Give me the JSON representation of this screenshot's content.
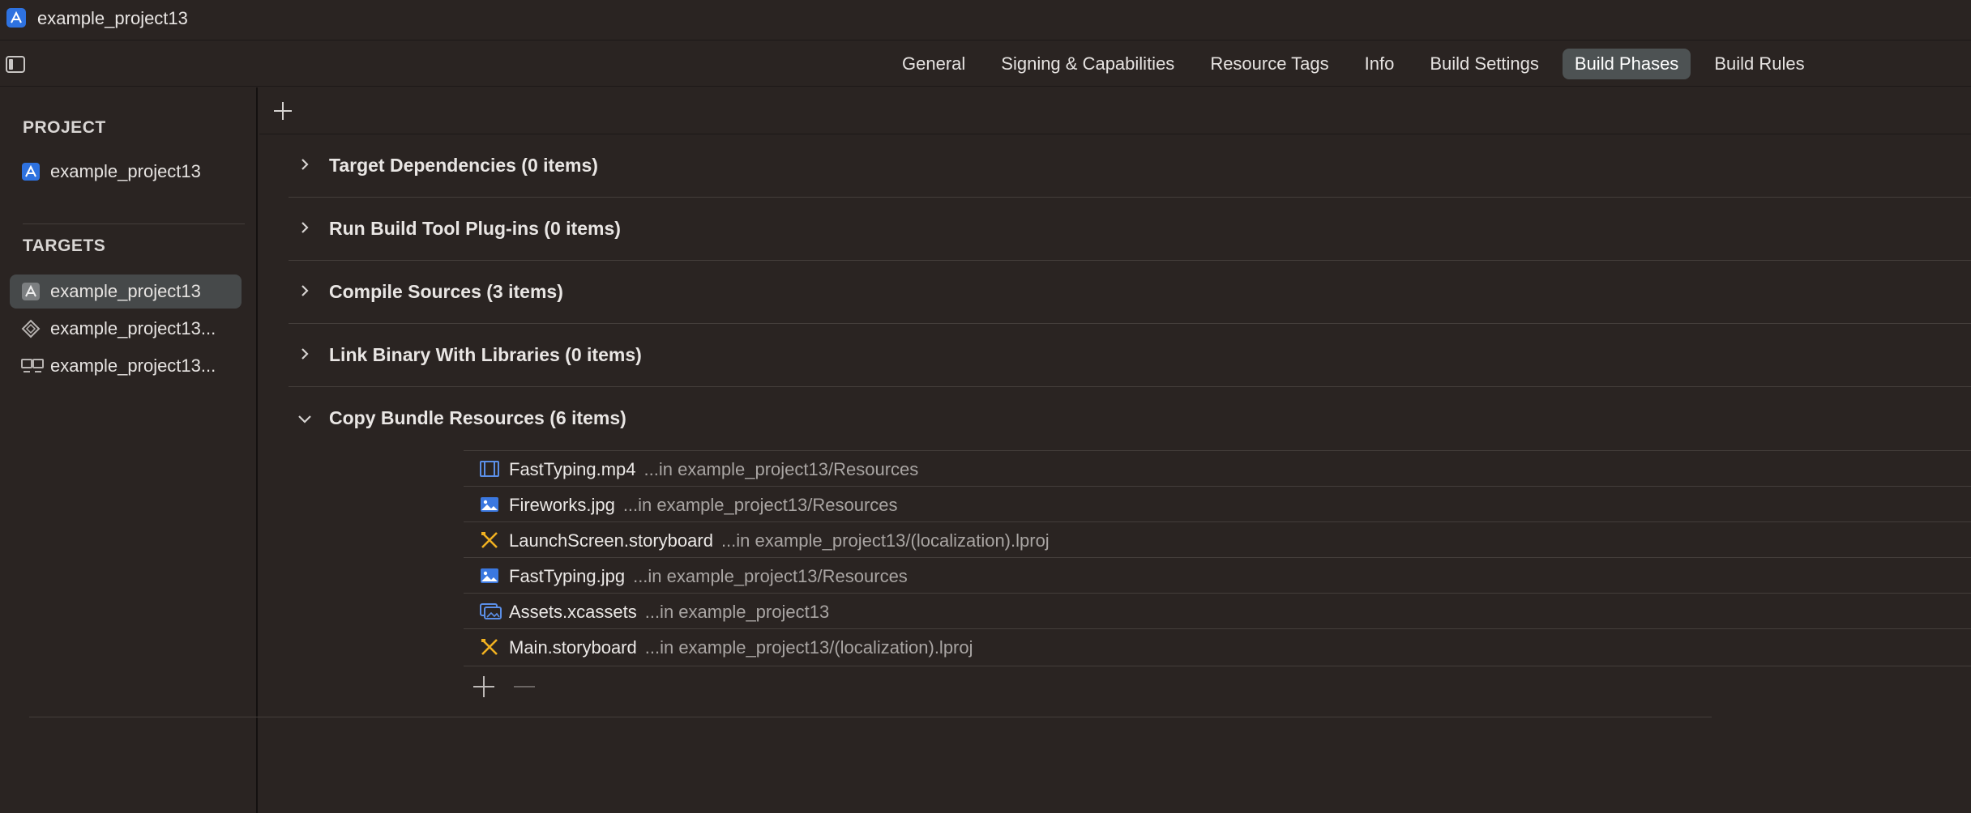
{
  "window": {
    "title": "example_project13",
    "icon": "app-icon"
  },
  "tabs": [
    {
      "label": "General",
      "active": false
    },
    {
      "label": "Signing & Capabilities",
      "active": false
    },
    {
      "label": "Resource Tags",
      "active": false
    },
    {
      "label": "Info",
      "active": false
    },
    {
      "label": "Build Settings",
      "active": false
    },
    {
      "label": "Build Phases",
      "active": true
    },
    {
      "label": "Build Rules",
      "active": false
    }
  ],
  "sidebar": {
    "project_header": "PROJECT",
    "project_item": "example_project13",
    "targets_header": "TARGETS",
    "targets": [
      {
        "label": "example_project13",
        "icon": "app-target-icon",
        "selected": true
      },
      {
        "label": "example_project13...",
        "icon": "test-target-icon",
        "selected": false
      },
      {
        "label": "example_project13...",
        "icon": "ui-test-target-icon",
        "selected": false
      }
    ]
  },
  "phases": [
    {
      "title": "Target Dependencies (0 items)",
      "expanded": false
    },
    {
      "title": "Run Build Tool Plug-ins (0 items)",
      "expanded": false
    },
    {
      "title": "Compile Sources (3 items)",
      "expanded": false
    },
    {
      "title": "Link Binary With Libraries (0 items)",
      "expanded": false
    },
    {
      "title": "Copy Bundle Resources (6 items)",
      "expanded": true
    }
  ],
  "resources": [
    {
      "name": "FastTyping.mp4",
      "path": "...in example_project13/Resources",
      "icon": "film-icon"
    },
    {
      "name": "Fireworks.jpg",
      "path": "...in example_project13/Resources",
      "icon": "image-icon"
    },
    {
      "name": "LaunchScreen.storyboard",
      "path": "...in example_project13/(localization).lproj",
      "icon": "storyboard-icon"
    },
    {
      "name": "FastTyping.jpg",
      "path": "...in example_project13/Resources",
      "icon": "image-icon"
    },
    {
      "name": "Assets.xcassets",
      "path": "...in example_project13",
      "icon": "asset-catalog-icon"
    },
    {
      "name": "Main.storyboard",
      "path": "...in example_project13/(localization).lproj",
      "icon": "storyboard-icon"
    }
  ],
  "colors": {
    "background": "#2a2422",
    "active_tab": "#4d5253",
    "selected_row": "#46494a",
    "accent_blue": "#2e72e0",
    "storyboard_yellow": "#f0b020"
  }
}
